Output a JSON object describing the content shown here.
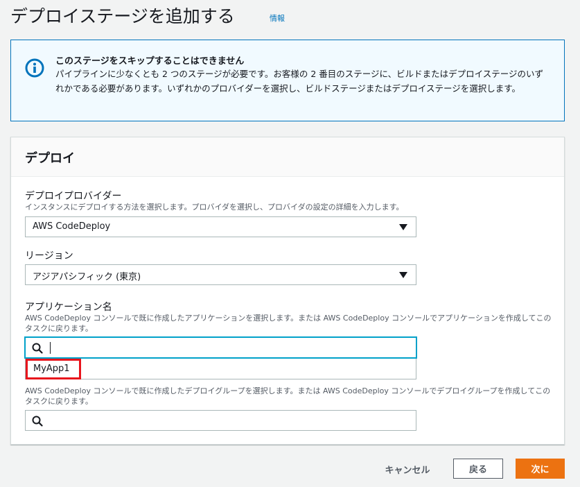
{
  "header": {
    "title": "デプロイステージを追加する",
    "info_link": "情報"
  },
  "alert": {
    "icon": "info-circle-icon",
    "title": "このステージをスキップすることはできません",
    "body": "パイプラインに少なくとも 2 つのステージが必要です。お客様の 2 番目のステージに、ビルドまたはデプロイステージのいずれかである必要があります。いずれかのプロバイダーを選択し、ビルドステージまたはデプロイステージを選択します。"
  },
  "panel": {
    "title": "デプロイ",
    "provider": {
      "label": "デプロイプロバイダー",
      "description": "インスタンスにデプロイする方法を選択します。プロバイダを選択し、プロバイダの設定の詳細を入力します。",
      "value": "AWS CodeDeploy"
    },
    "region": {
      "label": "リージョン",
      "value": "アジアパシフィック (東京)"
    },
    "application": {
      "label": "アプリケーション名",
      "description": "AWS CodeDeploy コンソールで既に作成したアプリケーションを選択します。または AWS CodeDeploy コンソールでアプリケーションを作成してこのタスクに戻ります。",
      "value": "",
      "options": [
        "MyApp1"
      ]
    },
    "deployment_group": {
      "description": "AWS CodeDeploy コンソールで既に作成したデプロイグループを選択します。または AWS CodeDeploy コンソールでデプロイグループを作成してこのタスクに戻ります。",
      "value": ""
    }
  },
  "footer": {
    "cancel_label": "キャンセル",
    "back_label": "戻る",
    "next_label": "次に"
  },
  "colors": {
    "accent": "#ec7211",
    "link": "#0073bb",
    "focus": "#00a1c9",
    "highlight": "#e8141c"
  }
}
